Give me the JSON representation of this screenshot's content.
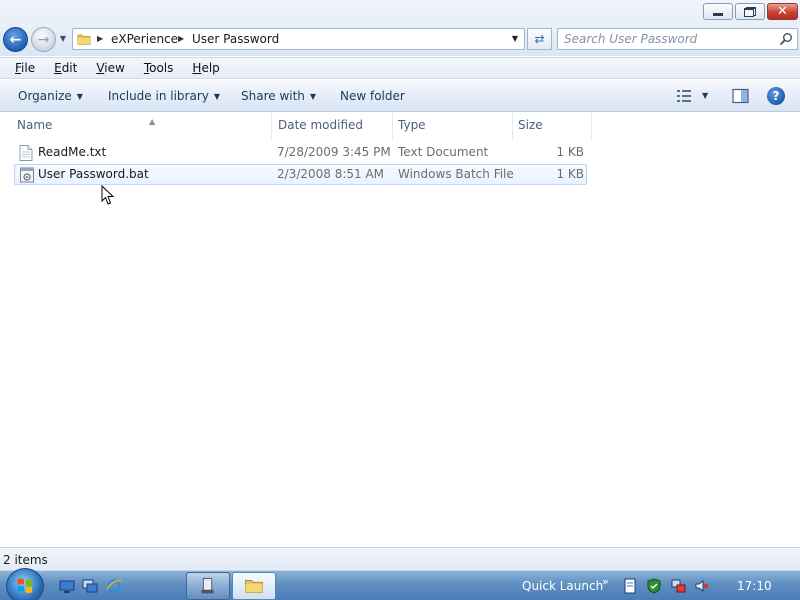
{
  "window": {
    "caption": {
      "minimize_icon": "minimize-icon",
      "maximize_icon": "restore-icon",
      "close_icon": "close-icon"
    }
  },
  "address_bar": {
    "breadcrumbs": [
      "eXPerience",
      "User Password"
    ],
    "search_placeholder": "Search User Password"
  },
  "menu": {
    "items": [
      "File",
      "Edit",
      "View",
      "Tools",
      "Help"
    ],
    "underlined": [
      "F",
      "E",
      "V",
      "T",
      "H"
    ]
  },
  "command_bar": {
    "organize": "Organize",
    "include_in_library": "Include in library",
    "share_with": "Share with",
    "new_folder": "New folder"
  },
  "file_list": {
    "columns": [
      "Name",
      "Date modified",
      "Type",
      "Size"
    ],
    "rows": [
      {
        "name": "ReadMe.txt",
        "date": "7/28/2009 3:45 PM",
        "type": "Text Document",
        "size": "1 KB",
        "icon": "text-file-icon"
      },
      {
        "name": "User Password.bat",
        "date": "2/3/2008 8:51 AM",
        "type": "Windows Batch File",
        "size": "1 KB",
        "icon": "batch-file-icon"
      }
    ]
  },
  "status_bar": {
    "items_count": "2 items"
  },
  "taskbar": {
    "quick_launch_label": "Quick Launch",
    "clock": "17:10"
  },
  "colors": {
    "accent": "#1e395b",
    "taskbar": "#5f8fc2",
    "selection_border": "#b8d6fb"
  }
}
